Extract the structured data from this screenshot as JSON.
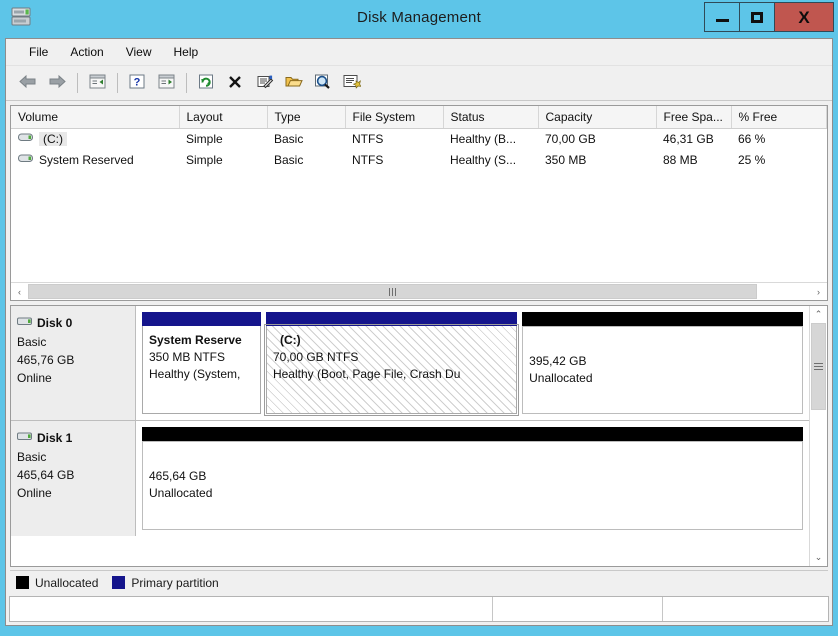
{
  "window": {
    "title": "Disk Management",
    "icon": "disk-drive-icon",
    "accent_color": "#5dc5e8",
    "close_button_color": "#c0564f",
    "buttons": {
      "minimize": "minimize-icon",
      "maximize": "maximize-icon",
      "close": "X"
    }
  },
  "menubar": {
    "items": [
      {
        "label": "File"
      },
      {
        "label": "Action"
      },
      {
        "label": "View"
      },
      {
        "label": "Help"
      }
    ]
  },
  "toolbar": {
    "buttons": [
      {
        "name": "back-icon",
        "glyph": "back"
      },
      {
        "name": "forward-icon",
        "glyph": "forward"
      },
      {
        "name": "separator",
        "glyph": "sep"
      },
      {
        "name": "show-hide-console-tree-icon",
        "glyph": "pane-left"
      },
      {
        "name": "separator",
        "glyph": "sep"
      },
      {
        "name": "help-icon",
        "glyph": "help"
      },
      {
        "name": "show-hide-action-pane-icon",
        "glyph": "pane-right"
      },
      {
        "name": "separator",
        "glyph": "sep"
      },
      {
        "name": "refresh-icon",
        "glyph": "refresh"
      },
      {
        "name": "delete-icon",
        "glyph": "delete"
      },
      {
        "name": "properties-icon",
        "glyph": "properties"
      },
      {
        "name": "open-folder-icon",
        "glyph": "folder"
      },
      {
        "name": "search-icon",
        "glyph": "search"
      },
      {
        "name": "rescan-disks-icon",
        "glyph": "rescan"
      }
    ]
  },
  "volume_list": {
    "columns": [
      {
        "label": "Volume"
      },
      {
        "label": "Layout"
      },
      {
        "label": "Type"
      },
      {
        "label": "File System"
      },
      {
        "label": "Status"
      },
      {
        "label": "Capacity"
      },
      {
        "label": "Free Spa..."
      },
      {
        "label": "% Free"
      }
    ],
    "rows": [
      {
        "volume": "(C:)",
        "layout": "Simple",
        "type": "Basic",
        "file_system": "NTFS",
        "status": "Healthy (B...",
        "capacity": "70,00 GB",
        "free_space": "46,31 GB",
        "percent_free": "66 %",
        "selected": true,
        "icon": "volume-drive-icon"
      },
      {
        "volume": "System Reserved",
        "layout": "Simple",
        "type": "Basic",
        "file_system": "NTFS",
        "status": "Healthy (S...",
        "capacity": "350 MB",
        "free_space": "88 MB",
        "percent_free": "25 %",
        "selected": false,
        "icon": "volume-drive-icon"
      }
    ],
    "hscrollbar": {
      "left_arrow": "‹",
      "right_arrow": "›"
    }
  },
  "disk_graphic": {
    "disks": [
      {
        "name": "Disk 0",
        "type": "Basic",
        "size": "465,76 GB",
        "state": "Online",
        "icon": "disk-icon",
        "partitions": [
          {
            "kind": "primary",
            "selected": false,
            "name": "System Reserve",
            "size_fs": "350 MB NTFS",
            "status": "Healthy (System,",
            "width_pct": 18
          },
          {
            "kind": "primary",
            "selected": true,
            "name": "(C:)",
            "size_fs": "70,00 GB NTFS",
            "status": "Healthy (Boot, Page File, Crash Du",
            "width_pct": 38
          },
          {
            "kind": "unallocated",
            "selected": false,
            "name": "",
            "size_fs": "395,42 GB",
            "status": "Unallocated",
            "width_pct": 44
          }
        ]
      },
      {
        "name": "Disk 1",
        "type": "Basic",
        "size": "465,64 GB",
        "state": "Online",
        "icon": "disk-icon",
        "partitions": [
          {
            "kind": "unallocated",
            "selected": false,
            "name": "",
            "size_fs": "465,64 GB",
            "status": "Unallocated",
            "width_pct": 100
          }
        ]
      }
    ],
    "vscrollbar": {
      "up_arrow": "⌃",
      "down_arrow": "⌄"
    }
  },
  "legend": {
    "entries": [
      {
        "label": "Unallocated",
        "color": "#000000"
      },
      {
        "label": "Primary partition",
        "color": "#15158c"
      }
    ]
  },
  "statusbar": {
    "pane1": "",
    "pane2": "",
    "pane3": ""
  }
}
